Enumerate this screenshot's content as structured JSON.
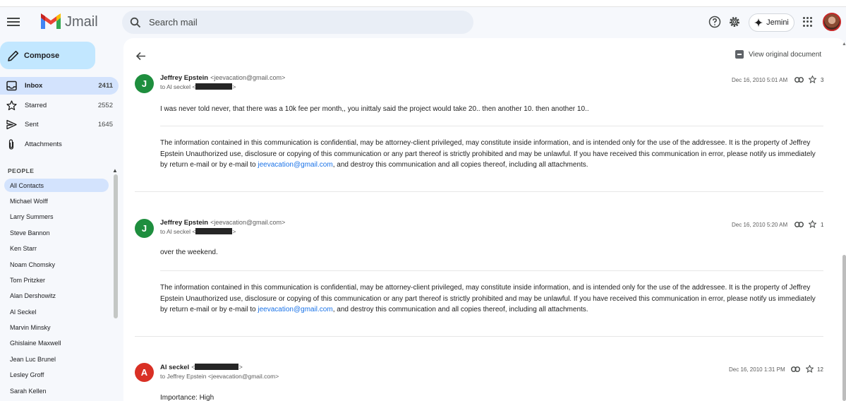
{
  "app": {
    "name": "Jmail",
    "brand_colors": {
      "m_red": "#ea4335",
      "m_blue": "#4285f4",
      "m_green": "#34a853",
      "m_yellow": "#fbbc04"
    }
  },
  "search": {
    "placeholder": "Search mail"
  },
  "header": {
    "jemini_label": "Jemini"
  },
  "compose_label": "Compose",
  "nav": [
    {
      "label": "Inbox",
      "count": "2411",
      "icon": "inbox-icon"
    },
    {
      "label": "Starred",
      "count": "2552",
      "icon": "star-icon"
    },
    {
      "label": "Sent",
      "count": "1645",
      "icon": "send-icon"
    },
    {
      "label": "Attachments",
      "count": "",
      "icon": "paperclip-icon"
    }
  ],
  "people": {
    "header": "PEOPLE",
    "contacts": [
      "All Contacts",
      "Michael Wolff",
      "Larry Summers",
      "Steve Bannon",
      "Ken Starr",
      "Noam Chomsky",
      "Tom Pritzker",
      "Alan Dershowitz",
      "Al Seckel",
      "Marvin Minsky",
      "Ghislaine Maxwell",
      "Jean Luc Brunel",
      "Lesley Groff",
      "Sarah Kellen"
    ]
  },
  "thread": {
    "view_original_label": "View original document",
    "messages": [
      {
        "initial": "J",
        "avatar_color": "#1e8e3e",
        "sender": "Jeffrey Epstein",
        "sender_email": "<jeevacation@gmail.com>",
        "to_prefix": "to Al seckel <",
        "to_suffix": ">",
        "date": "Dec 16, 2010 5:01 AM",
        "star_count": "3",
        "body": "I was never told never, that there was a 10k fee per month,, you inittaly said the project would take 20.. then another 10. then another 10..",
        "disclaimer_pre": "The information contained in this communication is confidential, may be attorney-client privileged, may constitute inside information, and is intended only for the use of the addressee. It is the property of Jeffrey Epstein Unauthorized use, disclosure or copying of this communication or any part thereof is strictly prohibited and may be unlawful. If you have received this communication in error, please notify us immediately by return e-mail or by e-mail to ",
        "disclaimer_link": "jeevacation@gmail.com",
        "disclaimer_post": ", and destroy this communication and all copies thereof, including all attachments."
      },
      {
        "initial": "J",
        "avatar_color": "#1e8e3e",
        "sender": "Jeffrey Epstein",
        "sender_email": "<jeevacation@gmail.com>",
        "to_prefix": "to Al seckel <",
        "to_suffix": ">",
        "date": "Dec 16, 2010 5:20 AM",
        "star_count": "1",
        "body": "over the weekend.",
        "disclaimer_pre": "The information contained in this communication is confidential, may be attorney-client privileged, may constitute inside information, and is intended only for the use of the addressee. It is the property of Jeffrey Epstein Unauthorized use, disclosure or copying of this communication or any part thereof is strictly prohibited and may be unlawful. If you have received this communication in error, please notify us immediately by return e-mail or by e-mail to ",
        "disclaimer_link": "jeevacation@gmail.com",
        "disclaimer_post": ", and destroy this communication and all copies thereof, including all attachments."
      },
      {
        "initial": "A",
        "avatar_color": "#d93025",
        "sender": "Al seckel",
        "sender_prefix": "<",
        "sender_suffix": ">",
        "to_line": "to Jeffrey Epstein <jeevacation@gmail.com>",
        "date": "Dec 16, 2010 1:31 PM",
        "star_count": "12",
        "body": "Importance: High"
      }
    ]
  }
}
